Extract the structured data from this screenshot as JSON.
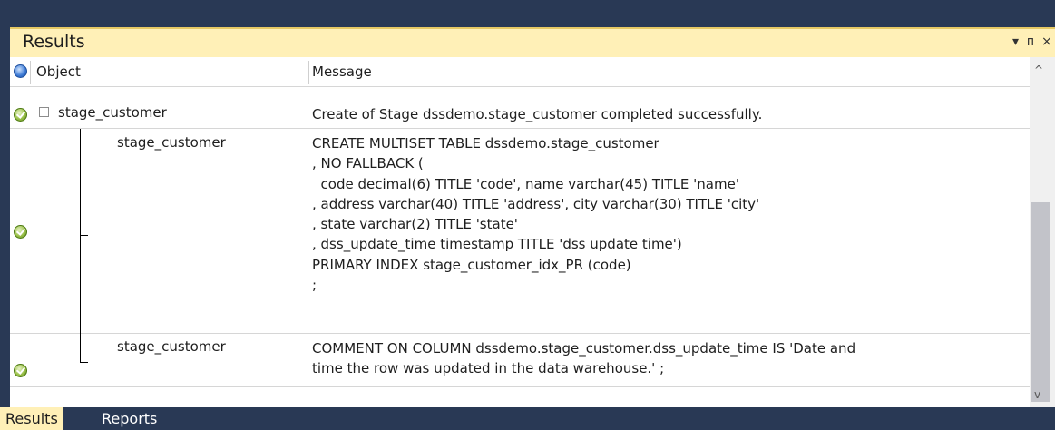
{
  "panel": {
    "title": "Results",
    "dropdown_glyph": "▾",
    "pin_glyph": "ᴨ",
    "close_glyph": "×"
  },
  "columns": {
    "icon": "info-icon",
    "object": "Object",
    "message": "Message"
  },
  "rows": [
    {
      "object": "stage_customer",
      "status": "success-icon",
      "message": "Create of Stage dssdemo.stage_customer completed successfully."
    },
    {
      "object": "stage_customer",
      "status": "success-icon",
      "message": "CREATE MULTISET TABLE dssdemo.stage_customer\n, NO FALLBACK (\n  code decimal(6) TITLE 'code', name varchar(45) TITLE 'name'\n, address varchar(40) TITLE 'address', city varchar(30) TITLE 'city'\n, state varchar(2) TITLE 'state'\n, dss_update_time timestamp TITLE 'dss update time')\nPRIMARY INDEX stage_customer_idx_PR (code)\n;"
    },
    {
      "object": "stage_customer",
      "status": "success-icon",
      "message": "COMMENT ON COLUMN dssdemo.stage_customer.dss_update_time IS 'Date and\ntime the row was updated in the data warehouse.' ;"
    }
  ],
  "scrollbar": {
    "up": "^",
    "down": "v"
  },
  "tabs": [
    {
      "label": "Results",
      "active": true
    },
    {
      "label": "Reports",
      "active": false
    }
  ],
  "colors": {
    "chrome": "#293955",
    "titlebar": "#fff0b7",
    "active_tab": "#fff0b7"
  }
}
